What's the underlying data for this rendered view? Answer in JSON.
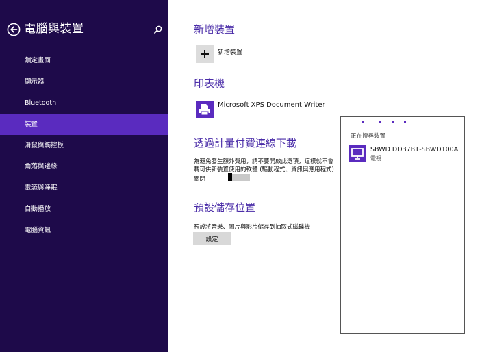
{
  "sidebar": {
    "title": "電腦與裝置",
    "items": [
      {
        "label": "鎖定畫面"
      },
      {
        "label": "顯示器"
      },
      {
        "label": "Bluetooth"
      },
      {
        "label": "裝置",
        "selected": true
      },
      {
        "label": "滑鼠與觸控板"
      },
      {
        "label": "角落與邊緣"
      },
      {
        "label": "電源與睡眠"
      },
      {
        "label": "自動播放"
      },
      {
        "label": "電腦資訊"
      }
    ]
  },
  "main": {
    "add_device": {
      "title": "新增裝置",
      "button_label": "新增裝置"
    },
    "printers": {
      "title": "印表機",
      "items": [
        {
          "label": "Microsoft XPS Document Writer"
        }
      ]
    },
    "metered": {
      "title": "透過計量付費連線下載",
      "description_line1": "為避免發生額外費用，請不要開啟此選項，這樣就不會",
      "description_line2": "載可供新裝置使用的軟體 (驅動程式、資訊與應用程式)",
      "toggle_label": "關閉",
      "toggle_on": false
    },
    "storage": {
      "title": "預設儲存位置",
      "description": "預設將音樂、圖片與影片儲存到抽取式磁碟機",
      "button_label": "設定"
    }
  },
  "flyout": {
    "status": "正在搜尋裝置",
    "devices": [
      {
        "name": "SBWD DD37B1-SBWD100A",
        "type": "電視"
      }
    ]
  },
  "colors": {
    "sidebar_bg": "#1e0a4a",
    "selected_bg": "#5a2bbf",
    "accent": "#4a2ca8"
  }
}
